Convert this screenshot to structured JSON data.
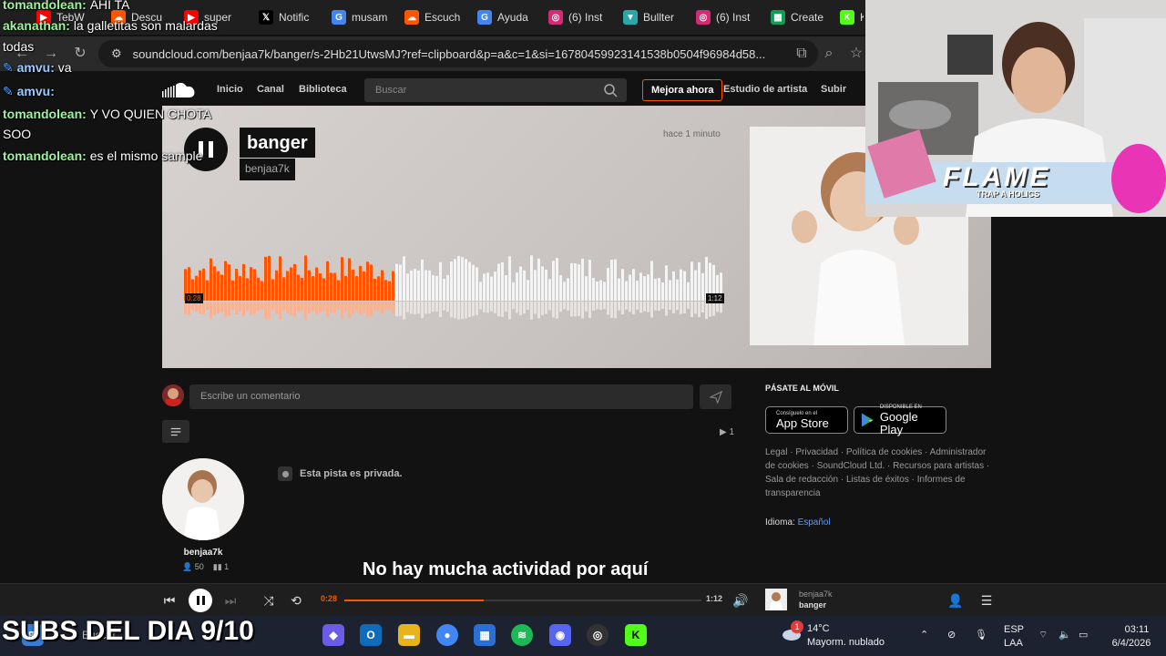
{
  "browser": {
    "tabs": [
      {
        "label": "TebW",
        "icon": "youtube-icon",
        "color": "#ff0000"
      },
      {
        "label": "Descu",
        "icon": "soundcloud-icon",
        "color": "#ff5500"
      },
      {
        "label": "super",
        "icon": "youtube-icon",
        "color": "#ff0000"
      },
      {
        "label": "Notific",
        "icon": "x-icon",
        "color": "#000000"
      },
      {
        "label": "musam",
        "icon": "google-icon",
        "color": "#4285f4"
      },
      {
        "label": "Escuch",
        "icon": "soundcloud-icon",
        "color": "#ff5500"
      },
      {
        "label": "Ayuda",
        "icon": "google-icon",
        "color": "#4285f4"
      },
      {
        "label": "(6) Inst",
        "icon": "instagram-icon",
        "color": "#d62976"
      },
      {
        "label": "Bullter",
        "icon": "bullter-icon",
        "color": "#2aa7a7"
      },
      {
        "label": "(6) Inst",
        "icon": "instagram-icon",
        "color": "#d62976"
      },
      {
        "label": "Create",
        "icon": "sheets-icon",
        "color": "#0f9d58"
      },
      {
        "label": "K",
        "icon": "kick-icon",
        "color": "#53fc18"
      }
    ],
    "url": "soundcloud.com/benjaa7k/banger/s-2Hb21UtwsMJ?ref=clipboard&p=a&c=1&si=16780459923141538b0504f96984d58..."
  },
  "soundcloud": {
    "nav": [
      "Inicio",
      "Canal",
      "Biblioteca"
    ],
    "search_placeholder": "Buscar",
    "upgrade_label": "Mejora ahora",
    "artist_studio_label": "Estudio de artista",
    "upload_label": "Subir",
    "track": {
      "title": "banger",
      "artist": "benjaa7k",
      "posted": "hace 1 minuto",
      "current_time": "0:28",
      "duration": "1:12",
      "played_fraction": 0.39
    },
    "comment_placeholder": "Escribe un comentario",
    "repost_count": "1",
    "private_note": "Esta pista es privada.",
    "artist_name": "benjaa7k",
    "artist_followers": "50",
    "artist_tracks": "1",
    "activity_message": "No hay mucha actividad por aquí",
    "mobile_title": "PÁSATE AL MÓVIL",
    "app_store": {
      "small": "Consíguelo en el",
      "big": "App Store"
    },
    "google_play": {
      "small": "DISPONIBLE EN",
      "big": "Google Play"
    },
    "footer_links": "Legal · Privacidad · Política de cookies · Administrador de cookies · SoundCloud Ltd. · Recursos para artistas · Sala de redacción · Listas de éxitos · Informes de transparencia",
    "language_label": "Idioma:",
    "language_value": "Español",
    "accent_color": "#ff5500"
  },
  "player": {
    "current_time": "0:28",
    "duration": "1:12",
    "artist": "benjaa7k",
    "title": "banger",
    "progress_fraction": 0.39
  },
  "chat": [
    {
      "user": "tomandolean",
      "msg": "AHI TA",
      "badge": false
    },
    {
      "user": "akanathan",
      "msg": "la galletitas son malardas",
      "badge": false
    },
    {
      "user": "",
      "msg": "todas",
      "badge": false
    },
    {
      "user": "amvu",
      "msg": "va",
      "badge": true
    },
    {
      "user": "amvu",
      "msg": "",
      "badge": true
    },
    {
      "user": "tomandolean",
      "msg": "Y VO QUIEN CHOTA",
      "badge": false
    },
    {
      "user": "",
      "msg": "SOO",
      "badge": false
    },
    {
      "user": "tomandolean",
      "msg": "es el mismo sample",
      "badge": false
    }
  ],
  "webcam": {
    "banner_text": "FLAME",
    "banner_sub": "TRAP A HOLICS"
  },
  "taskbar": {
    "subs_banner": "SUBS DEL DIA 9/10",
    "search_label": "Buscar",
    "weather_temp": "14°C",
    "weather_desc": "Mayorm. nublado",
    "lang_line1": "ESP",
    "lang_line2": "LAA",
    "time": "03:11",
    "date": "6/4/2026",
    "notif_count": "1"
  }
}
